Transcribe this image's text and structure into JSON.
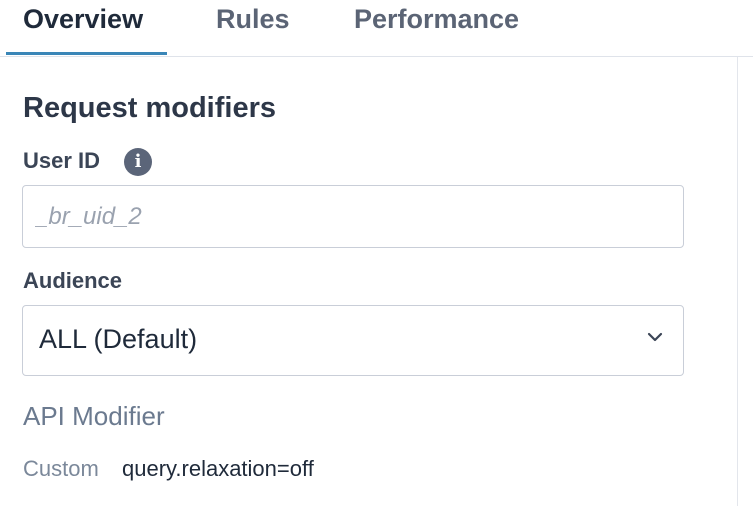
{
  "tabs": [
    {
      "label": "Overview",
      "active": true
    },
    {
      "label": "Rules",
      "active": false
    },
    {
      "label": "Performance",
      "active": false
    }
  ],
  "section": {
    "title": "Request modifiers"
  },
  "user_id": {
    "label": "User ID",
    "info_icon": "info-icon",
    "value": "",
    "placeholder": "_br_uid_2"
  },
  "audience": {
    "label": "Audience",
    "selected": "ALL (Default)",
    "chevron_icon": "chevron-down-icon"
  },
  "api_modifier": {
    "title": "API Modifier",
    "custom_label": "Custom",
    "custom_value": "query.relaxation=off"
  },
  "colors": {
    "tab_accent": "#3a86b7",
    "text_dark": "#1f2a3a",
    "muted": "#6b7a8f"
  }
}
